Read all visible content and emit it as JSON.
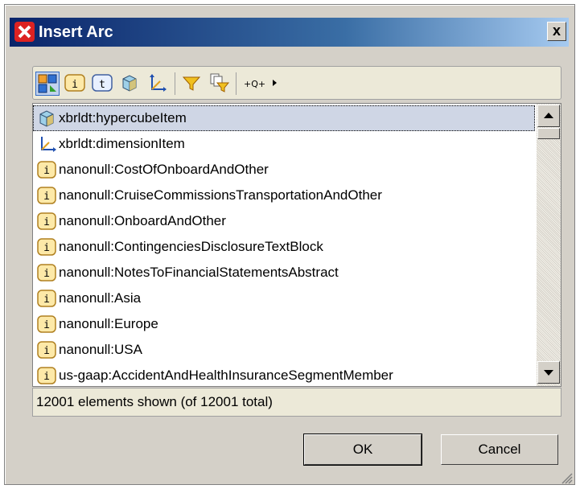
{
  "window": {
    "title": "Insert Arc",
    "close_label": "x"
  },
  "toolbar": {
    "buttons": [
      {
        "name": "show-all-icon",
        "active": true
      },
      {
        "name": "item-icon"
      },
      {
        "name": "tuple-icon"
      },
      {
        "name": "hypercube-icon"
      },
      {
        "name": "dimension-icon"
      },
      {
        "name": "filter-icon"
      },
      {
        "name": "filter-options-icon"
      },
      {
        "name": "namespace-prefix-toggle-icon"
      }
    ]
  },
  "list": {
    "items": [
      {
        "label": "xbrldt:hypercubeItem",
        "icon": "hypercube-icon",
        "selected": true
      },
      {
        "label": "xbrldt:dimensionItem",
        "icon": "dimension-icon"
      },
      {
        "label": "nanonull:CostOfOnboardAndOther",
        "icon": "item-icon"
      },
      {
        "label": "nanonull:CruiseCommissionsTransportationAndOther",
        "icon": "item-icon"
      },
      {
        "label": "nanonull:OnboardAndOther",
        "icon": "item-icon"
      },
      {
        "label": "nanonull:ContingenciesDisclosureTextBlock",
        "icon": "item-icon"
      },
      {
        "label": "nanonull:NotesToFinancialStatementsAbstract",
        "icon": "item-icon"
      },
      {
        "label": "nanonull:Asia",
        "icon": "item-icon"
      },
      {
        "label": "nanonull:Europe",
        "icon": "item-icon"
      },
      {
        "label": "nanonull:USA",
        "icon": "item-icon"
      },
      {
        "label": "us-gaap:AccidentAndHealthInsuranceSegmentMember",
        "icon": "item-icon"
      }
    ]
  },
  "status": {
    "text": "12001 elements shown (of 12001 total)"
  },
  "buttons": {
    "ok_label": "OK",
    "cancel_label": "Cancel"
  },
  "colors": {
    "title_gradient_start": "#0a246a",
    "title_gradient_end": "#a6caf0",
    "item_icon_fill": "#fde9a8",
    "selection": "#cfd6e5"
  }
}
